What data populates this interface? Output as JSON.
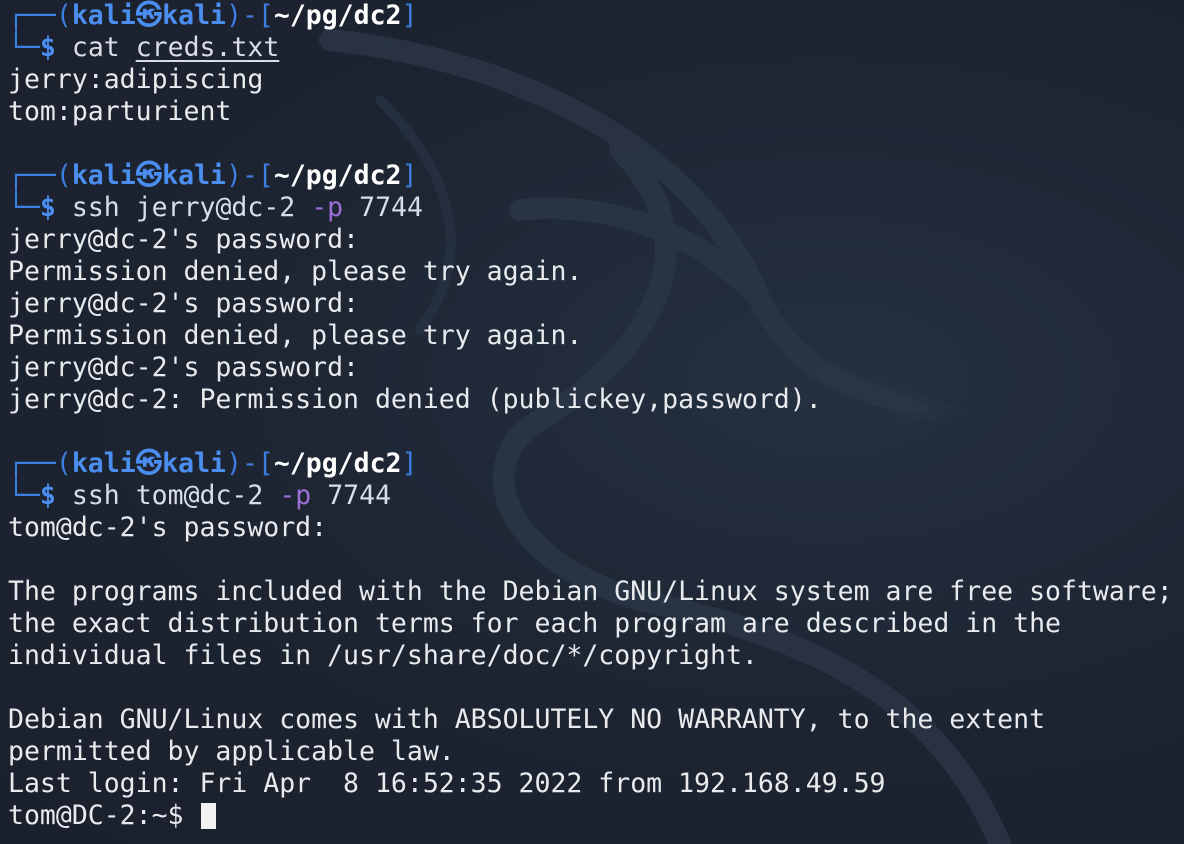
{
  "prompt": {
    "top_left": "┌──(",
    "user": "kali",
    "symbol": "㉿",
    "host": "kali",
    "mid": ")-[",
    "cwd": "~/pg/dc2",
    "close": "]",
    "bottom_left": "└─",
    "dollar": "$"
  },
  "blocks": [
    {
      "command": {
        "name": "cat",
        "arg1": "creds.txt"
      },
      "output": [
        "jerry:adipiscing",
        "tom:parturient"
      ]
    },
    {
      "command": {
        "name": "ssh",
        "arg1": "jerry@dc-2",
        "flag": "-p",
        "arg2": "7744"
      },
      "output": [
        "jerry@dc-2's password:",
        "Permission denied, please try again.",
        "jerry@dc-2's password:",
        "Permission denied, please try again.",
        "jerry@dc-2's password:",
        "jerry@dc-2: Permission denied (publickey,password)."
      ]
    },
    {
      "command": {
        "name": "ssh",
        "arg1": "tom@dc-2",
        "flag": "-p",
        "arg2": "7744"
      },
      "output": [
        "tom@dc-2's password:",
        "",
        "The programs included with the Debian GNU/Linux system are free software;",
        "the exact distribution terms for each program are described in the",
        "individual files in /usr/share/doc/*/copyright.",
        "",
        "Debian GNU/Linux comes with ABSOLUTELY NO WARRANTY, to the extent",
        "permitted by applicable law.",
        "Last login: Fri Apr  8 16:52:35 2022 from 192.168.49.59"
      ]
    }
  ],
  "remote_prompt": "tom@DC-2:~$ ",
  "icons": {
    "watermark": "kali-dragon-icon",
    "cursor": "block-cursor"
  },
  "colors": {
    "background": "#1c2330",
    "prompt_blue": "#4c8ef0",
    "flag_purple": "#9a6fd6",
    "text": "#e8eaee"
  }
}
